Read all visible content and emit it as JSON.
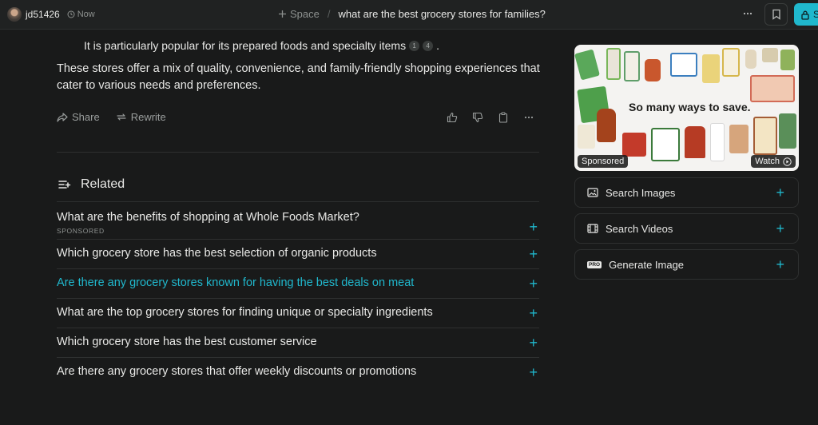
{
  "header": {
    "username": "jd51426",
    "time": "Now",
    "space_label": "Space",
    "title": "what are the best grocery stores for families?",
    "share_label": "S"
  },
  "answer": {
    "tail_text": "It is particularly popular for its prepared foods and specialty items",
    "citations": [
      "1",
      "4"
    ],
    "tail_period": ".",
    "summary": "These stores offer a mix of quality, convenience, and family-friendly shopping experiences that cater to various needs and preferences."
  },
  "actions": {
    "share": "Share",
    "rewrite": "Rewrite"
  },
  "related": {
    "heading": "Related",
    "items": [
      {
        "text": "What are the benefits of shopping at Whole Foods Market?",
        "tag": "SPONSORED"
      },
      {
        "text": "Which grocery store has the best selection of organic products"
      },
      {
        "text": "Are there any grocery stores known for having the best deals on meat"
      },
      {
        "text": "What are the top grocery stores for finding unique or specialty ingredients"
      },
      {
        "text": "Which grocery store has the best customer service"
      },
      {
        "text": "Are there any grocery stores that offer weekly discounts or promotions"
      }
    ]
  },
  "sidebar": {
    "ad": {
      "headline": "So many ways to save.",
      "sponsored": "Sponsored",
      "watch": "Watch"
    },
    "search_images": "Search Images",
    "search_videos": "Search Videos",
    "generate_image": "Generate Image",
    "pro_badge": "PRO"
  },
  "colors": {
    "accent": "#20b8cd",
    "background": "#191a1a",
    "topbar": "#202222",
    "text": "#e8e8e6",
    "muted": "#8d918f"
  }
}
